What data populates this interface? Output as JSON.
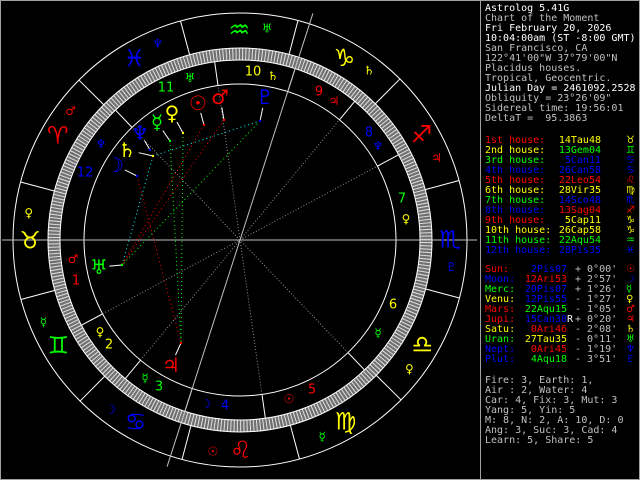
{
  "colors": {
    "fire": "#ff0000",
    "earth": "#ffff00",
    "air": "#00ff00",
    "water": "#0000ff",
    "white": "#ffffff",
    "gray": "#c0c0c0",
    "cyan": "#00ffff"
  },
  "info_lines": [
    {
      "text": "Astrolog 5.41G",
      "color": "#ffffff"
    },
    {
      "text": "Chart of the Moment",
      "color": "#c0c0c0"
    },
    {
      "text": "Fri February 20, 2026",
      "color": "#ffffff"
    },
    {
      "text": "10:04:00am (ST -8:00 GMT)",
      "color": "#ffffff"
    },
    {
      "text": "San Francisco, CA",
      "color": "#c0c0c0"
    },
    {
      "text": "122°41'00\"W 37°79'00\"N",
      "color": "#c0c0c0"
    },
    {
      "text": "Placidus houses.",
      "color": "#c0c0c0"
    },
    {
      "text": "Tropical, Geocentric.",
      "color": "#c0c0c0"
    },
    {
      "text": "Julian Day = 2461092.2528",
      "color": "#ffffff"
    },
    {
      "text": "Obliquity = 23°26'09\"",
      "color": "#c0c0c0"
    },
    {
      "text": "Sidereal time: 19:56:01",
      "color": "#c0c0c0"
    },
    {
      "text": "DeltaT =  95.3863",
      "color": "#c0c0c0"
    }
  ],
  "houses": [
    {
      "label": "1st house:",
      "value": "14Tau48",
      "glyph": "♉",
      "label_color": "#ff0000",
      "value_color": "#ffff00"
    },
    {
      "label": "2nd house:",
      "value": "13Gem04",
      "glyph": "♊",
      "label_color": "#ffff00",
      "value_color": "#00ff00"
    },
    {
      "label": "3rd house:",
      "value": "5Can11",
      "glyph": "♋",
      "label_color": "#00ff00",
      "value_color": "#0000ff"
    },
    {
      "label": "4th house:",
      "value": "26Can58",
      "glyph": "♋",
      "label_color": "#0000ff",
      "value_color": "#0000ff"
    },
    {
      "label": "5th house:",
      "value": "22Leo54",
      "glyph": "♌",
      "label_color": "#ff0000",
      "value_color": "#ff0000"
    },
    {
      "label": "6th house:",
      "value": "28Vir35",
      "glyph": "♍",
      "label_color": "#ffff00",
      "value_color": "#ffff00"
    },
    {
      "label": "7th house:",
      "value": "14Sco48",
      "glyph": "♏",
      "label_color": "#00ff00",
      "value_color": "#0000ff"
    },
    {
      "label": "8th house:",
      "value": "13Sag04",
      "glyph": "♐",
      "label_color": "#0000ff",
      "value_color": "#ff0000"
    },
    {
      "label": "9th house:",
      "value": "5Cap11",
      "glyph": "♑",
      "label_color": "#ff0000",
      "value_color": "#ffff00"
    },
    {
      "label": "10th house:",
      "value": "26Cap58",
      "glyph": "♑",
      "label_color": "#ffff00",
      "value_color": "#ffff00"
    },
    {
      "label": "11th house:",
      "value": "22Aqu54",
      "glyph": "♒",
      "label_color": "#00ff00",
      "value_color": "#00ff00"
    },
    {
      "label": "12th house:",
      "value": "28Pis35",
      "glyph": "♓",
      "label_color": "#0000ff",
      "value_color": "#0000ff"
    }
  ],
  "planets": [
    {
      "name": "Sun:",
      "value": "2Pis07",
      "retro": "",
      "lat": "+ 0°00'",
      "glyph": "☉",
      "color": "#ff0000",
      "value_color": "#0000ff"
    },
    {
      "name": "Moon:",
      "value": "12Ari53",
      "retro": "",
      "lat": "+ 2°57'",
      "glyph": "☽",
      "color": "#0000ff",
      "value_color": "#ff0000"
    },
    {
      "name": "Merc:",
      "value": "20Pis07",
      "retro": "",
      "lat": "+ 1°26'",
      "glyph": "☿",
      "color": "#00ff00",
      "value_color": "#0000ff"
    },
    {
      "name": "Venu:",
      "value": "12Pis55",
      "retro": "",
      "lat": "- 1°27'",
      "glyph": "♀",
      "color": "#ffff00",
      "value_color": "#0000ff"
    },
    {
      "name": "Mars:",
      "value": "22Aqu15",
      "retro": "",
      "lat": "- 1°05'",
      "glyph": "♂",
      "color": "#ff0000",
      "value_color": "#00ff00"
    },
    {
      "name": "Jupi:",
      "value": "15Can38",
      "retro": "R",
      "lat": "+ 0°20'",
      "glyph": "♃",
      "color": "#ff0000",
      "value_color": "#0000ff"
    },
    {
      "name": "Satu:",
      "value": "0Ari46",
      "retro": "",
      "lat": "- 2°08'",
      "glyph": "♄",
      "color": "#ffff00",
      "value_color": "#ff0000"
    },
    {
      "name": "Uran:",
      "value": "27Tau35",
      "retro": "",
      "lat": "- 0°11'",
      "glyph": "♅",
      "color": "#00ff00",
      "value_color": "#ffff00"
    },
    {
      "name": "Nept:",
      "value": "0Ari45",
      "retro": "",
      "lat": "- 1°19'",
      "glyph": "♆",
      "color": "#0000ff",
      "value_color": "#ff0000"
    },
    {
      "name": "Plut:",
      "value": "4Aqu18",
      "retro": "",
      "lat": "- 3°51'",
      "glyph": "♇",
      "color": "#0000ff",
      "value_color": "#00ff00"
    }
  ],
  "stats": [
    "Fire: 3, Earth: 1,",
    "Air : 2, Water: 4",
    "Car: 4, Fix: 3, Mut: 3",
    "Yang: 5, Yin: 5",
    "M: 8, N: 2, A: 10, D: 0",
    "Ang: 3, Suc: 3, Cad: 4",
    "Learn: 5, Share: 5"
  ],
  "wheel": {
    "signs": [
      {
        "glyph": "♈",
        "ruler": "♂",
        "color": "#ff0000",
        "ruler_color": "#ff0000"
      },
      {
        "glyph": "♉",
        "ruler": "♀",
        "color": "#ffff00",
        "ruler_color": "#ffff00"
      },
      {
        "glyph": "♊",
        "ruler": "☿",
        "color": "#00ff00",
        "ruler_color": "#00ff00"
      },
      {
        "glyph": "♋",
        "ruler": "☽",
        "color": "#0000ff",
        "ruler_color": "#0000ff"
      },
      {
        "glyph": "♌",
        "ruler": "☉",
        "color": "#ff0000",
        "ruler_color": "#ff0000"
      },
      {
        "glyph": "♍",
        "ruler": "☿",
        "color": "#ffff00",
        "ruler_color": "#00ff00"
      },
      {
        "glyph": "♎",
        "ruler": "♀",
        "color": "#ffff00",
        "ruler_color": "#ffff00"
      },
      {
        "glyph": "♏",
        "ruler": "♇",
        "color": "#0000ff",
        "ruler_color": "#0000ff"
      },
      {
        "glyph": "♐",
        "ruler": "♃",
        "color": "#ff0000",
        "ruler_color": "#ff0000"
      },
      {
        "glyph": "♑",
        "ruler": "♄",
        "color": "#ffff00",
        "ruler_color": "#ffff00"
      },
      {
        "glyph": "♒",
        "ruler": "♅",
        "color": "#00ff00",
        "ruler_color": "#00ff00"
      },
      {
        "glyph": "♓",
        "ruler": "♆",
        "color": "#0000ff",
        "ruler_color": "#0000ff"
      }
    ],
    "house_labels": [
      {
        "number": "1",
        "ruler": "♂",
        "color": "#ff0000",
        "ruler_color": "#ff0000"
      },
      {
        "number": "2",
        "ruler": "♀",
        "color": "#ffff00",
        "ruler_color": "#ffff00"
      },
      {
        "number": "3",
        "ruler": "☿",
        "color": "#00ff00",
        "ruler_color": "#00ff00"
      },
      {
        "number": "4",
        "ruler": "☽",
        "color": "#0000ff",
        "ruler_color": "#0000ff"
      },
      {
        "number": "5",
        "ruler": "☉",
        "color": "#ff0000",
        "ruler_color": "#ff0000"
      },
      {
        "number": "6",
        "ruler": "☿",
        "color": "#ffff00",
        "ruler_color": "#00ff00"
      },
      {
        "number": "7",
        "ruler": "♀",
        "color": "#00ff00",
        "ruler_color": "#ffff00"
      },
      {
        "number": "8",
        "ruler": "♆",
        "color": "#0000ff",
        "ruler_color": "#0000ff"
      },
      {
        "number": "9",
        "ruler": "♃",
        "color": "#ff0000",
        "ruler_color": "#ff0000"
      },
      {
        "number": "10",
        "ruler": "♄",
        "color": "#ffff00",
        "ruler_color": "#ffff00"
      },
      {
        "number": "11",
        "ruler": "♅",
        "color": "#00ff00",
        "ruler_color": "#00ff00"
      },
      {
        "number": "12",
        "ruler": "♆",
        "color": "#0000ff",
        "ruler_color": "#0000ff"
      }
    ],
    "aspect_lines": [
      {
        "from": "Satu:",
        "to": "Plut:",
        "color": "#00ffff"
      },
      {
        "from": "Satu:",
        "to": "Uran:",
        "color": "#00ffff"
      },
      {
        "from": "Moon:",
        "to": "Jupi:",
        "color": "#ff0000"
      },
      {
        "from": "Sun:",
        "to": "Uran:",
        "color": "#ff0000"
      },
      {
        "from": "Mars:",
        "to": "Uran:",
        "color": "#ff0000"
      },
      {
        "from": "Plut:",
        "to": "Uran:",
        "color": "#00ff00"
      },
      {
        "from": "Venu:",
        "to": "Jupi:",
        "color": "#00ff00"
      },
      {
        "from": "Merc:",
        "to": "Jupi:",
        "color": "#00ff00"
      }
    ]
  }
}
